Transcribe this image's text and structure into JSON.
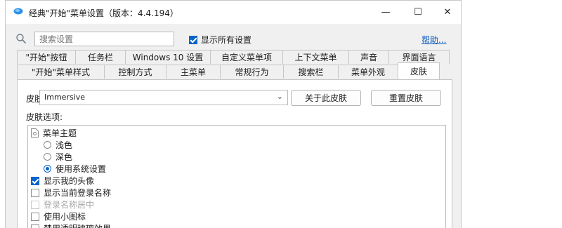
{
  "window": {
    "title": "经典\"开始\"菜单设置（版本：4.4.194）"
  },
  "title_controls": {
    "minimize": "—",
    "maximize": "☐",
    "close": "✕"
  },
  "toolbar": {
    "search_placeholder": "搜索设置",
    "show_all_label": "显示所有设置",
    "show_all_checked": true,
    "help_label": "帮助..."
  },
  "tabs_row1": [
    "\"开始\"按钮",
    "任务栏",
    "Windows 10 设置",
    "自定义菜单项",
    "上下文菜单",
    "声音",
    "界面语言"
  ],
  "tabs_row2": [
    "\"开始\"菜单样式",
    "控制方式",
    "主菜单",
    "常规行为",
    "搜索栏",
    "菜单外观",
    "皮肤"
  ],
  "active_tab": "皮肤",
  "skin": {
    "label": "皮肤:",
    "value": "Immersive",
    "about_button": "关于此皮肤",
    "reset_button": "重置皮肤",
    "options_label": "皮肤选项:"
  },
  "options": {
    "menu_theme": "菜单主题",
    "theme_light": "浅色",
    "theme_dark": "深色",
    "theme_system": "使用系统设置",
    "show_avatar": "显示我的头像",
    "show_login_name": "显示当前登录名称",
    "login_name_centered": "登录名称居中",
    "small_icons": "使用小图标",
    "disable_transparency": "禁用透明玻璃效果"
  },
  "colors": {
    "accent": "#0a63c9",
    "link": "#0b5cbd"
  }
}
